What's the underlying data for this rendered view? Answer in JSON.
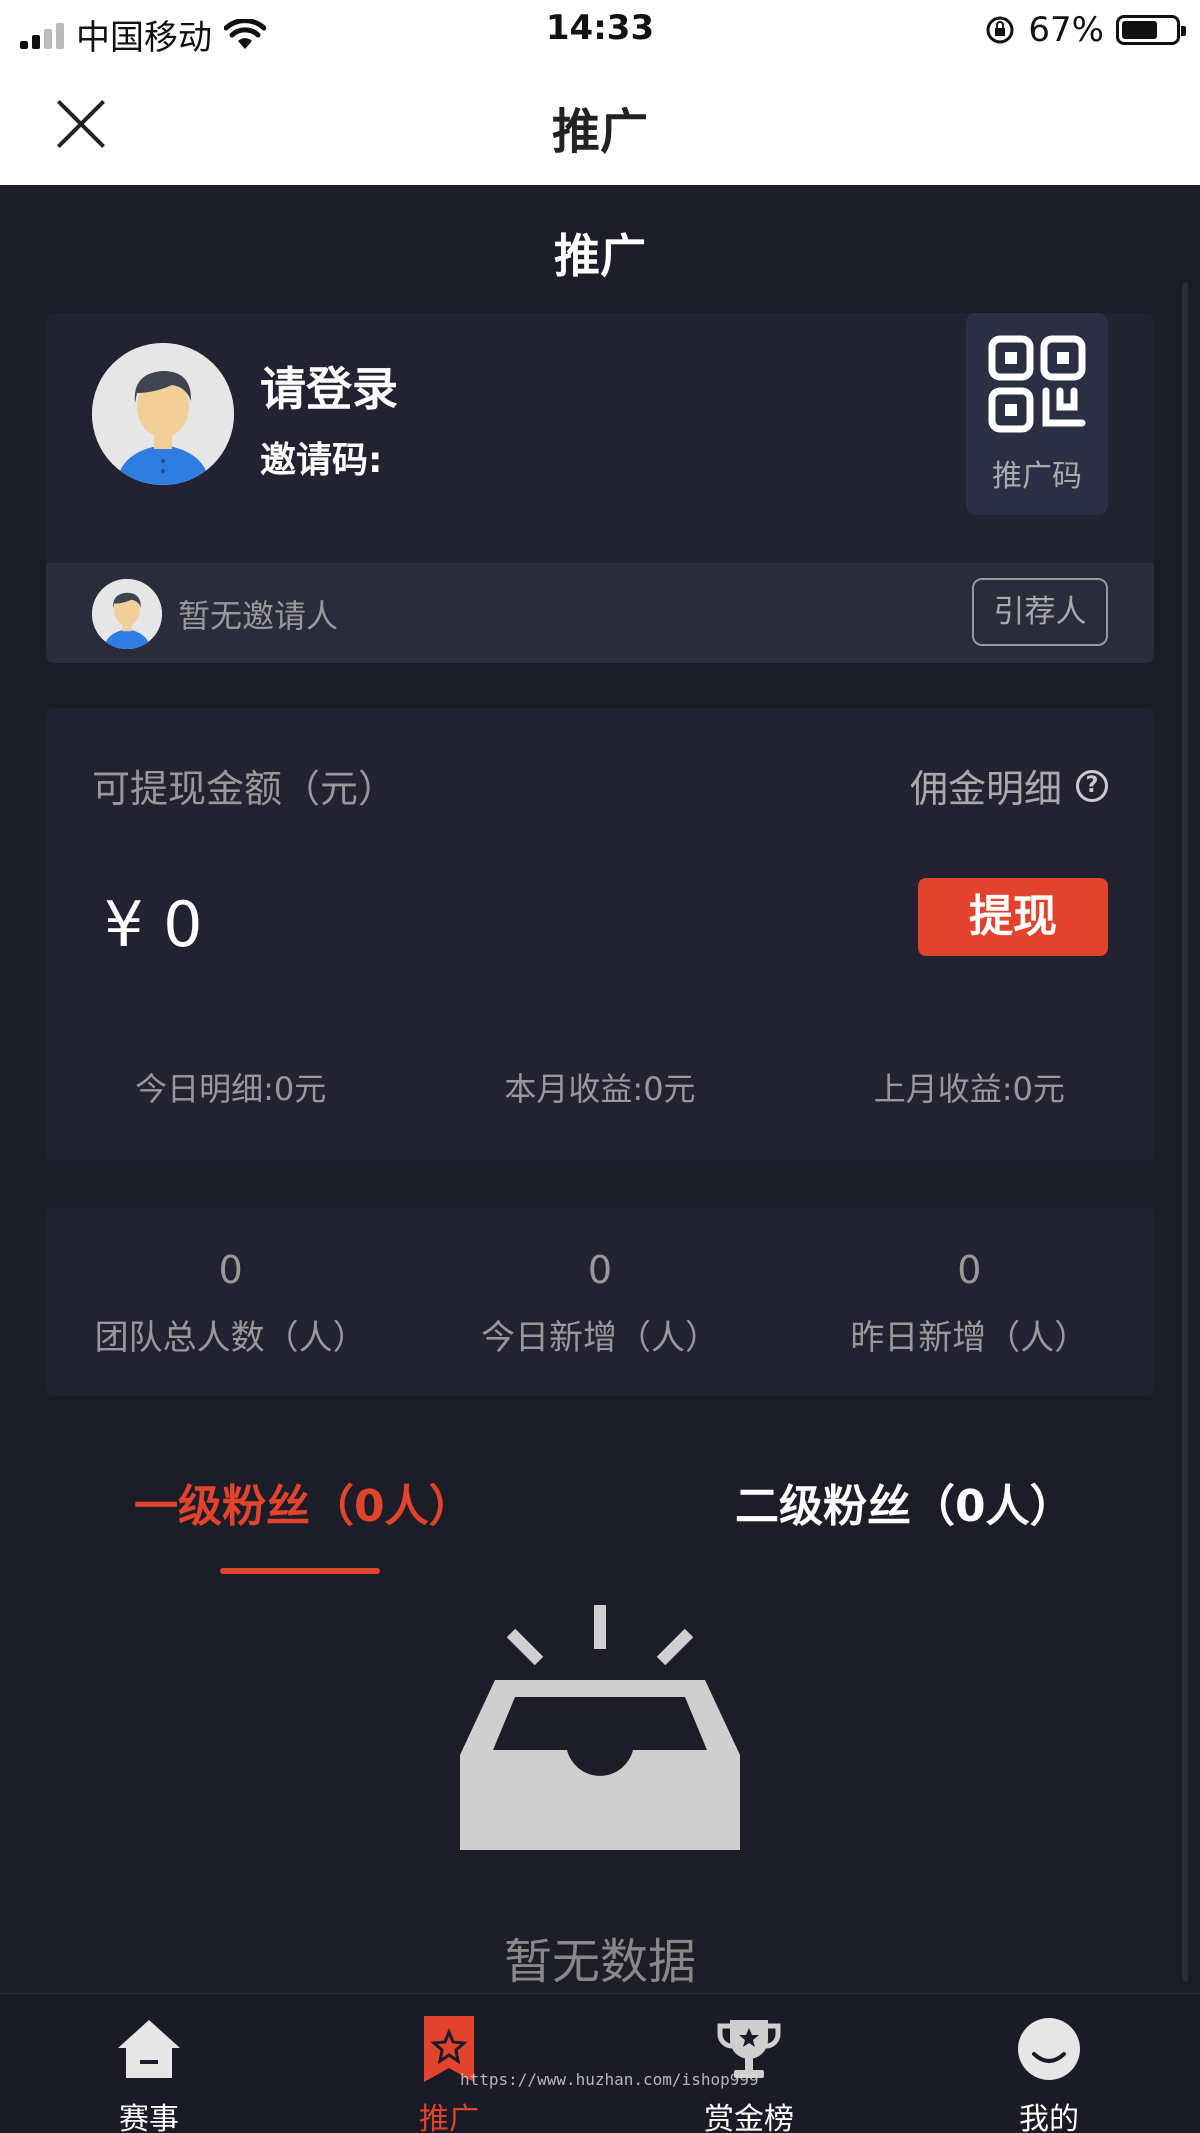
{
  "status_bar": {
    "carrier": "中国移动",
    "time": "14:33",
    "battery": "67%"
  },
  "header": {
    "title": "推广"
  },
  "page": {
    "title": "推广"
  },
  "profile": {
    "login_prompt": "请登录",
    "invite_code_label": "邀请码:",
    "qr_label": "推广码",
    "no_inviter": "暂无邀请人",
    "referrer_button": "引荐人"
  },
  "wallet": {
    "withdrawable_label": "可提现金额（元）",
    "commission_link": "佣金明细",
    "balance": "¥ 0",
    "withdraw_button": "提现",
    "stats": [
      "今日明细:0元",
      "本月收益:0元",
      "上月收益:0元"
    ]
  },
  "team": [
    {
      "value": "0",
      "label": "团队总人数（人）"
    },
    {
      "value": "0",
      "label": "今日新增（人）"
    },
    {
      "value": "0",
      "label": "昨日新增（人）"
    }
  ],
  "fan_tabs": {
    "level1": "一级粉丝（0人）",
    "level2": "二级粉丝（0人）",
    "active": "level1"
  },
  "empty_state": {
    "text": "暂无数据"
  },
  "bottom_nav": [
    {
      "label": "赛事",
      "icon": "home-icon"
    },
    {
      "label": "推广",
      "icon": "promote-bookmark-icon",
      "active": true
    },
    {
      "label": "赏金榜",
      "icon": "trophy-icon"
    },
    {
      "label": "我的",
      "icon": "profile-face-icon"
    }
  ],
  "watermark": "https://www.huzhan.com/ishop999",
  "colors": {
    "accent": "#e2432c",
    "background": "#1d1d27",
    "card": "#222233"
  }
}
